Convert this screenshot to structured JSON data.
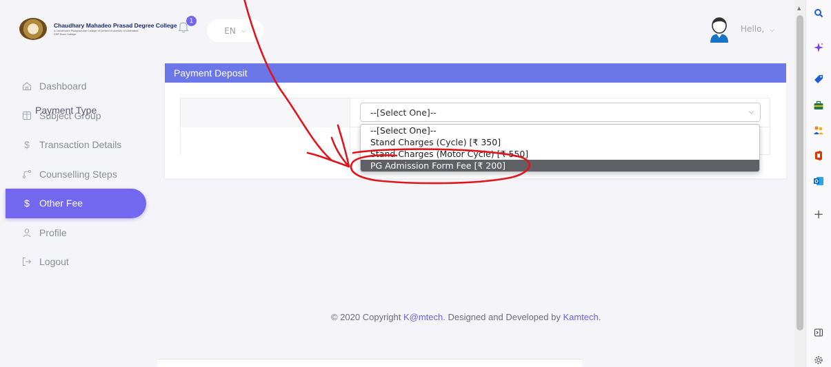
{
  "college": {
    "name": "Chaudhary Mahadeo Prasad Degree College",
    "subtitle": "A Constituent Postgraduate College of Central University of Allahabad",
    "tagline": "CMP Doon College"
  },
  "sidebar": {
    "items": [
      {
        "label": "Dashboard",
        "icon": "home-icon"
      },
      {
        "label": "Subject Group",
        "icon": "grid-icon"
      },
      {
        "label": "Transaction Details",
        "icon": "dollar-icon"
      },
      {
        "label": "Counselling Steps",
        "icon": "route-icon"
      },
      {
        "label": "Other Fee",
        "icon": "dollar-icon",
        "active": true
      },
      {
        "label": "Profile",
        "icon": "user-icon"
      },
      {
        "label": "Logout",
        "icon": "logout-icon"
      }
    ]
  },
  "topbar": {
    "notification_count": "1",
    "language": "EN",
    "greeting": "Hello,"
  },
  "card": {
    "title": "Payment Deposit",
    "field_label": "Payment Type",
    "selected": "--[Select One]--",
    "options": [
      "--[Select One]--",
      "Stand Charges (Cycle) [₹ 350]",
      "Stand Charges (Motor Cycle) [₹ 550]",
      "PG Admission Form Fee [₹ 200]"
    ],
    "highlighted_option": 3
  },
  "footer": {
    "prefix": "© 2020 Copyright ",
    "brand": "K@mtech",
    "middle": ". Designed and Developed by ",
    "developer": "Kamtech",
    "suffix": "."
  },
  "colors": {
    "accent": "#7367f0",
    "header": "#6b76e8",
    "annotation": "#e0141b"
  }
}
